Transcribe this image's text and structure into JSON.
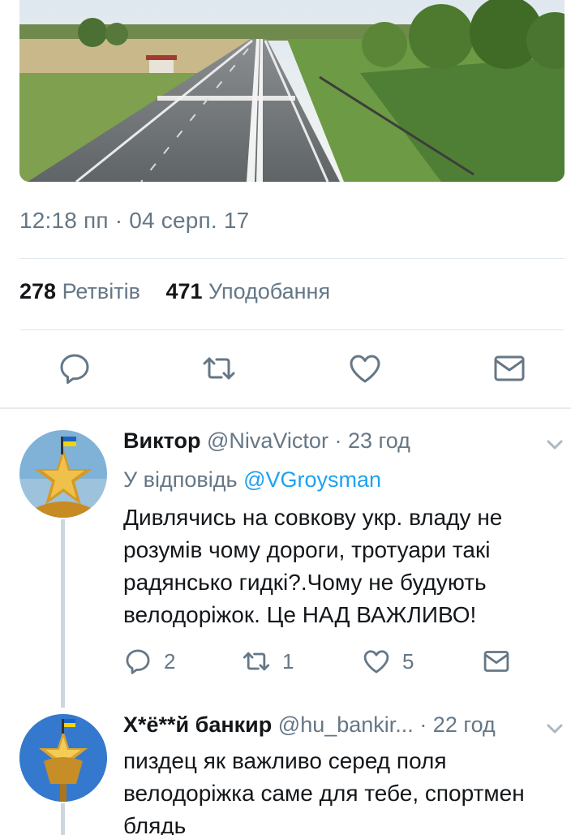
{
  "tweet": {
    "timestamp": "12:18 пп · 04 серп. 17",
    "retweets_count": "278",
    "retweets_label": "Ретвітів",
    "likes_count": "471",
    "likes_label": "Уподобання",
    "actions": [
      "reply-icon",
      "retweet-icon",
      "like-icon",
      "message-icon"
    ]
  },
  "replies": [
    {
      "name": "Виктор",
      "handle": "@NivaVictor",
      "time": "· 23 год",
      "reply_to_prefix": "У відповідь",
      "reply_to_handle": "@VGroysman",
      "text": "Дивлячись на совкову укр. владу не\nрозумів чому дороги, тротуари такі\nрадянсько гидкі?.Чому не будують\nвелодоріжок. Це НАД ВАЖЛИВО!",
      "reply_count": "2",
      "retweet_count": "1",
      "like_count": "5"
    },
    {
      "name": "Х*ё**й банкир",
      "handle": "@hu_bankir...",
      "time": "· 22 год",
      "text": "пиздец як важливо серед поля\nвелодоріжка саме для тебе, спортмен\nблядь"
    }
  ],
  "colors": {
    "accent": "#1da1f2",
    "secondary_text": "#657786",
    "primary_text": "#14171a",
    "divider": "#e1e8ed"
  }
}
